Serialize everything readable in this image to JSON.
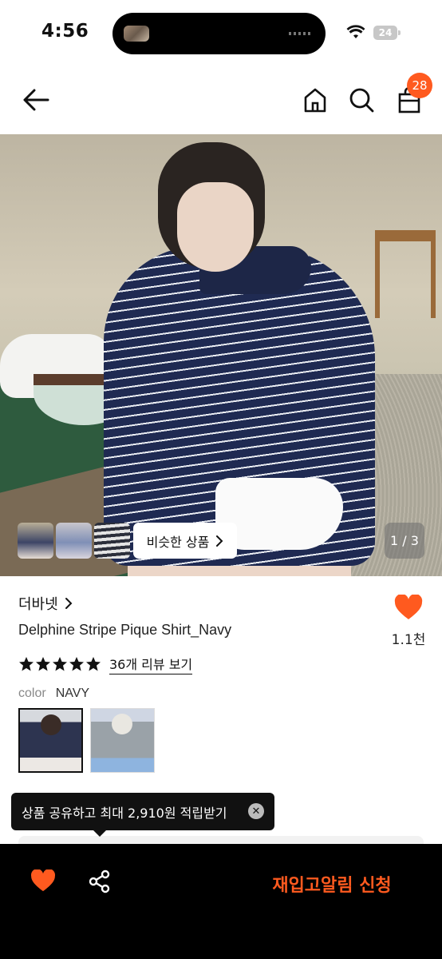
{
  "status_bar": {
    "time": "4:56",
    "battery_level": "24"
  },
  "nav": {
    "cart_count": "28"
  },
  "gallery": {
    "similar_label": "비슷한 상품",
    "page_indicator": "1 / 3"
  },
  "product": {
    "brand": "더바넷",
    "name": "Delphine Stripe Pique Shirt_Navy",
    "like_count": "1.1천",
    "rating_stars": 5,
    "review_link": "36개 리뷰 보기",
    "color_label": "color",
    "color_value": "NAVY"
  },
  "tooltip": {
    "text": "상품 공유하고 최대 2,910원 적립받기"
  },
  "bottom_bar": {
    "restock_label": "재입고알림 신청"
  },
  "colors": {
    "accent": "#ff5a1f",
    "bar_bg": "#000000"
  }
}
